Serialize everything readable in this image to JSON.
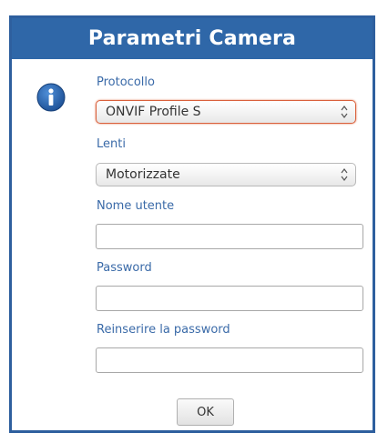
{
  "dialog": {
    "title": "Parametri Camera",
    "ok_label": "OK"
  },
  "fields": {
    "protocol": {
      "label": "Protocollo",
      "selected": "ONVIF Profile S"
    },
    "lens": {
      "label": "Lenti",
      "selected": "Motorizzate"
    },
    "username": {
      "label": "Nome utente",
      "value": ""
    },
    "password": {
      "label": "Password",
      "value": ""
    },
    "password_confirm": {
      "label": "Reinserire la password",
      "value": ""
    }
  },
  "icons": {
    "info": "info-icon"
  },
  "colors": {
    "title_bar": "#2f67a8",
    "frame_border": "#2e5f9e",
    "label_text": "#3a6aa8",
    "focus_border": "#d9603b"
  }
}
